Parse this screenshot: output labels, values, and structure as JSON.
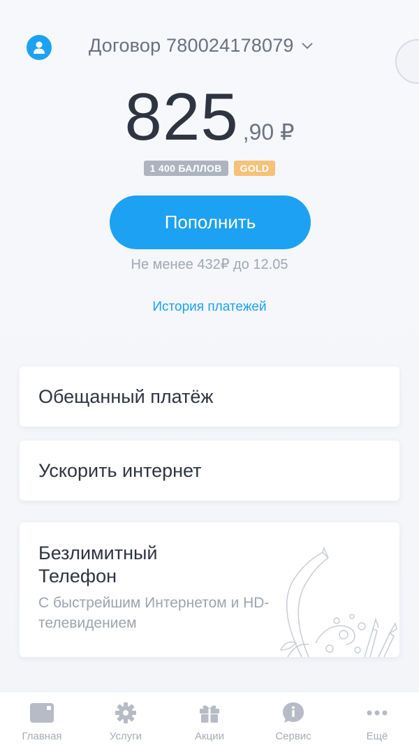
{
  "header": {
    "contract_label": "Договор 780024178079"
  },
  "balance": {
    "integer": "825",
    "fraction": ",90 ₽"
  },
  "badges": {
    "points": "1 400 БАЛЛОВ",
    "tier": "GOLD"
  },
  "topup": {
    "label": "Пополнить",
    "hint": "Не менее 432₽ до 12.05"
  },
  "history_link": "История платежей",
  "cards": {
    "promised_payment": "Обещанный платёж",
    "speed_up": "Ускорить интернет",
    "promo": {
      "title": "Безлимитный Телефон",
      "subtitle": "С быстрейшим Интернетом и HD-телевидением"
    }
  },
  "tabbar": [
    {
      "label": "Главная",
      "icon": "home-icon"
    },
    {
      "label": "Услуги",
      "icon": "gear-icon"
    },
    {
      "label": "Акции",
      "icon": "gift-icon"
    },
    {
      "label": "Сервис",
      "icon": "info-icon"
    },
    {
      "label": "Ещё",
      "icon": "more-icon"
    }
  ],
  "colors": {
    "accent": "#1da1f2",
    "gold": "#f6c27a",
    "points_badge": "#aeb4bf",
    "text": "#2f3441",
    "muted": "#a2a7b2"
  }
}
